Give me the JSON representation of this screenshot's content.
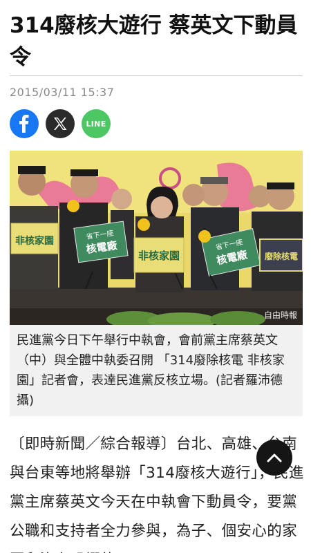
{
  "article": {
    "headline": "314廢核大遊行 蔡英文下動員令",
    "timestamp": "2015/03/11 15:37",
    "photo": {
      "credit": "自由時報",
      "signs": {
        "left": "非核家園",
        "center_top": "省下一座",
        "center_bottom": "核電廠",
        "center": "非核家園",
        "right_top": "省下一座",
        "right_bottom": "核電廠",
        "far_right": "廢除核電"
      }
    },
    "caption": "民進黨今日下午舉行中執會，會前黨主席蔡英文（中）與全體中執委召開 「314廢除核電 非核家園」記者會，表達民進黨反核立場。(記者羅沛德攝)",
    "body": "〔即時新聞／綜合報導〕台北、高雄、台南與台東等地將舉辦「314廢核大遊行」，民進黨主席蔡英文今天在中執會下動員令，要黨公職和支持者全力參與，為子、個安心的家園和沒有恐懼的"
  },
  "share": {
    "facebook": "facebook-share",
    "x": "x-share",
    "line_label": "LINE"
  },
  "colors": {
    "facebook": "#1877f2",
    "x": "#2b2b2b",
    "line": "#4cc764",
    "caption_bg": "#f1f1f1",
    "sign_green": "#3f8a5e",
    "sign_yellow": "#e8dd76"
  },
  "icons": [
    "facebook-icon",
    "x-icon",
    "line-icon",
    "chevron-up-icon"
  ]
}
